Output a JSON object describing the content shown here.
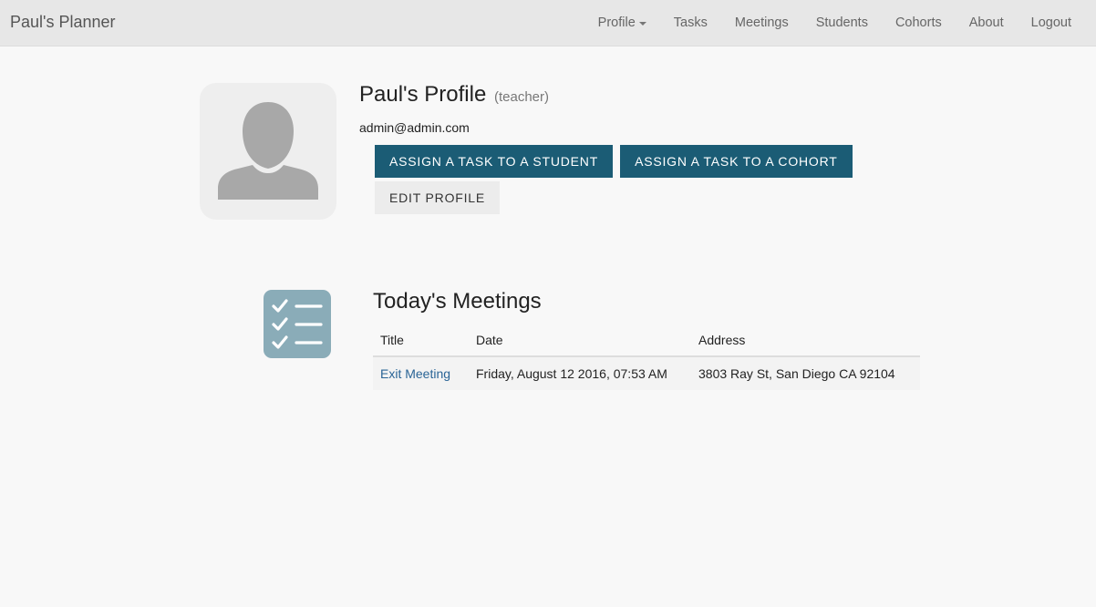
{
  "navbar": {
    "brand": "Paul's Planner",
    "items": [
      {
        "label": "Profile",
        "dropdown": true
      },
      {
        "label": "Tasks"
      },
      {
        "label": "Meetings"
      },
      {
        "label": "Students"
      },
      {
        "label": "Cohorts"
      },
      {
        "label": "About"
      },
      {
        "label": "Logout"
      }
    ]
  },
  "profile": {
    "avatar_icon": "user-silhouette-icon",
    "name": "Paul's Profile",
    "role": "(teacher)",
    "email": "admin@admin.com",
    "buttons": {
      "assign_student": "ASSIGN A TASK TO A STUDENT",
      "assign_cohort": "ASSIGN A TASK TO A COHORT",
      "edit_profile": "EDIT PROFILE"
    }
  },
  "meetings": {
    "icon": "checklist-icon",
    "heading": "Today's Meetings",
    "columns": [
      "Title",
      "Date",
      "Address"
    ],
    "rows": [
      {
        "title": "Exit Meeting",
        "date": "Friday, August 12 2016, 07:53 AM",
        "address": "3803 Ray St, San Diego CA 92104"
      }
    ]
  },
  "colors": {
    "primary_button": "#1b5c75",
    "navbar_bg": "#e7e7e7",
    "icon_tile": "#8aacb8",
    "link": "#2a6496"
  }
}
